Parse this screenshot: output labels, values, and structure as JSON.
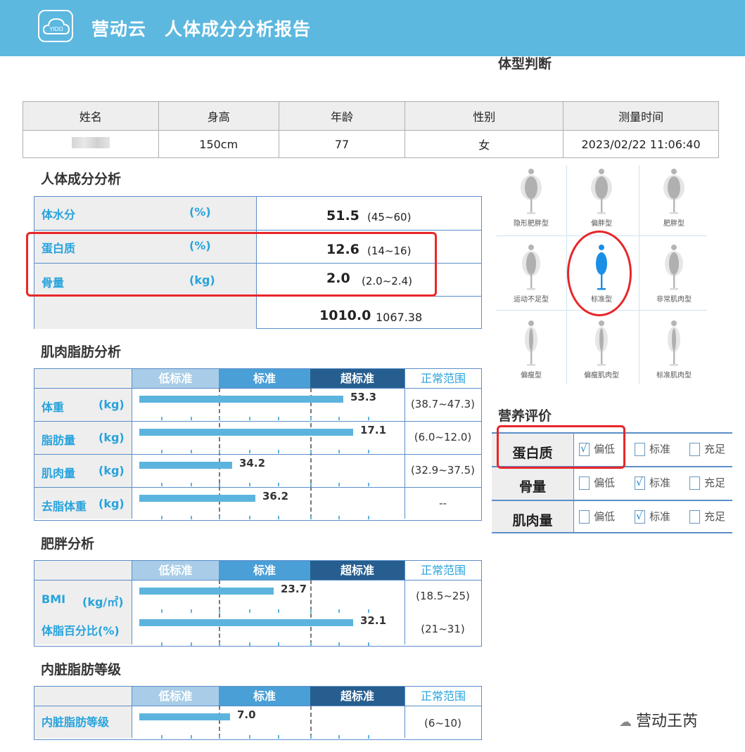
{
  "header": {
    "title": "营动云　人体成分分析报告",
    "logo_text": "YIDO"
  },
  "body_type_title": "体型判断",
  "info": {
    "headers": [
      "姓名",
      "身高",
      "年龄",
      "性别",
      "测量时间"
    ],
    "values": [
      "",
      "150cm",
      "77",
      "女",
      "2023/02/22 11:06:40"
    ]
  },
  "composition": {
    "title": "人体成分分析",
    "rows": [
      {
        "name": "体水分",
        "unit": "(%)",
        "value": "51.5",
        "range": "(45~60)"
      },
      {
        "name": "蛋白质",
        "unit": "(%)",
        "value": "12.6",
        "range": "(14~16)"
      },
      {
        "name": "骨量",
        "unit": "(kg)",
        "value": "2.0",
        "range": "(2.0~2.4)"
      },
      {
        "name": "",
        "unit": "",
        "value": "1010.0",
        "range": "1067.38"
      }
    ]
  },
  "bar_headers": {
    "low": "低标准",
    "standard": "标准",
    "high": "超标准",
    "range": "正常范围"
  },
  "muscle_fat": {
    "title": "肌肉脂肪分析",
    "rows": [
      {
        "name": "体重",
        "unit": "(kg)",
        "value": "53.3",
        "bar_fraction": 0.88,
        "range": "(38.7~47.3)"
      },
      {
        "name": "脂肪量",
        "unit": "(kg)",
        "value": "17.1",
        "bar_fraction": 0.92,
        "range": "(6.0~12.0)"
      },
      {
        "name": "肌肉量",
        "unit": "(kg)",
        "value": "34.2",
        "bar_fraction": 0.4,
        "range": "(32.9~37.5)"
      },
      {
        "name": "去脂体重",
        "unit": "(kg)",
        "value": "36.2",
        "bar_fraction": 0.5,
        "range": "--"
      }
    ]
  },
  "obesity": {
    "title": "肥胖分析",
    "rows": [
      {
        "name": "BMI",
        "unit": "(kg/㎡)",
        "value": "23.7",
        "bar_fraction": 0.58,
        "range": "(18.5~25)"
      },
      {
        "name": "体脂百分比(%)",
        "unit": "",
        "value": "32.1",
        "bar_fraction": 0.92,
        "range": "(21~31)"
      }
    ]
  },
  "visceral": {
    "title": "内脏脂肪等级",
    "rows": [
      {
        "name": "内脏脂肪等级",
        "unit": "",
        "value": "7.0",
        "bar_fraction": 0.39,
        "range": "(6~10)"
      }
    ]
  },
  "body_types": [
    {
      "label": "隐形肥胖型",
      "selected": false,
      "shape": "wide"
    },
    {
      "label": "偏胖型",
      "selected": false,
      "shape": "wide"
    },
    {
      "label": "肥胖型",
      "selected": false,
      "shape": "wide"
    },
    {
      "label": "运动不足型",
      "selected": false,
      "shape": "mid"
    },
    {
      "label": "标准型",
      "selected": true,
      "shape": "mid"
    },
    {
      "label": "非常肌肉型",
      "selected": false,
      "shape": "mid"
    },
    {
      "label": "偏瘦型",
      "selected": false,
      "shape": "thin"
    },
    {
      "label": "偏瘦肌肉型",
      "selected": false,
      "shape": "thin"
    },
    {
      "label": "标准肌肉型",
      "selected": false,
      "shape": "thin"
    }
  ],
  "nutrition": {
    "title": "营养评价",
    "options": [
      "偏低",
      "标准",
      "充足"
    ],
    "rows": [
      {
        "name": "蛋白质",
        "checked": "偏低"
      },
      {
        "name": "骨量",
        "checked": "标准"
      },
      {
        "name": "肌肉量",
        "checked": "标准"
      }
    ]
  },
  "watermark": "营动王芮",
  "colors": {
    "header_bg": "#5cb8df",
    "accent": "#27a3dc",
    "highlight": "#e8262a",
    "bar": "#5cb4de"
  }
}
